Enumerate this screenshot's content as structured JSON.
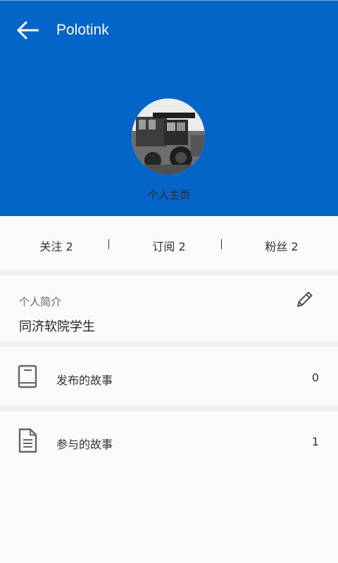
{
  "header": {
    "title": "Polotink",
    "profile_label": "个人主页",
    "background_color": "#0465c8"
  },
  "stats": {
    "following": "关注 2",
    "subscriptions": "订阅 2",
    "fans": "粉丝 2",
    "separator": "|"
  },
  "bio": {
    "label": "个人简介",
    "text": "同济软院学生"
  },
  "story_rows": [
    {
      "icon": "book-icon",
      "label": "发布的故事",
      "count": "0"
    },
    {
      "icon": "document-icon",
      "label": "参与的故事",
      "count": "1"
    }
  ],
  "icons": {
    "back": "arrow-left-icon",
    "edit": "pencil-icon"
  }
}
